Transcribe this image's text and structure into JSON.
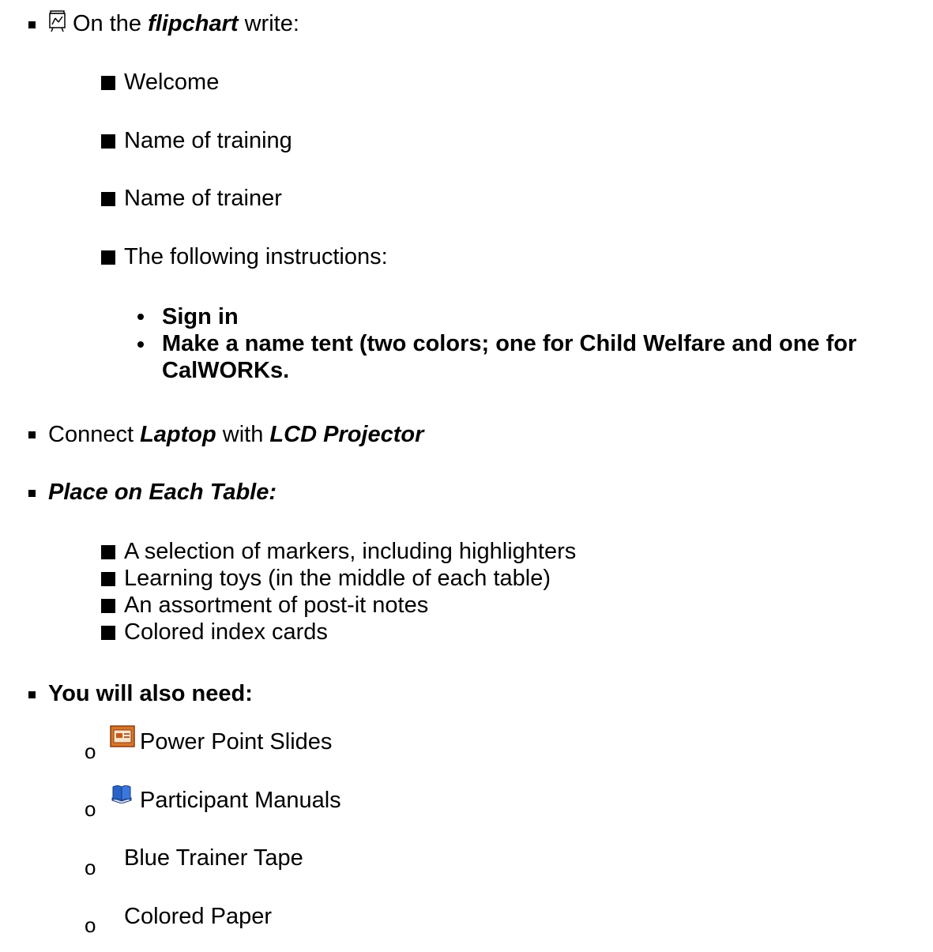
{
  "section1": {
    "lead": "On the ",
    "emph": "flipchart",
    "tail": " write:",
    "icon": "flipchart-icon",
    "items": [
      "Welcome",
      "Name of training",
      "Name of trainer",
      "The following instructions:"
    ],
    "sub": [
      "Sign in",
      "Make a name tent (two colors; one for Child Welfare and one for",
      "CalWORKs."
    ]
  },
  "section2": {
    "lead": "Connect ",
    "laptop": "Laptop",
    "mid": " with ",
    "projector": "LCD Projector"
  },
  "section3": {
    "title": "Place on Each Table:",
    "items": [
      "A selection of markers, including highlighters",
      "Learning toys (in the middle of each table)",
      "An assortment of post-it notes",
      "Colored index cards"
    ]
  },
  "section4": {
    "title": "You will also need:",
    "items": [
      {
        "label": "Power Point Slides",
        "icon": "slides-icon"
      },
      {
        "label": "Participant Manuals",
        "icon": "manual-icon"
      },
      {
        "label": "Blue Trainer Tape",
        "icon": ""
      },
      {
        "label": "Colored Paper",
        "icon": ""
      }
    ],
    "bullet": "o"
  }
}
